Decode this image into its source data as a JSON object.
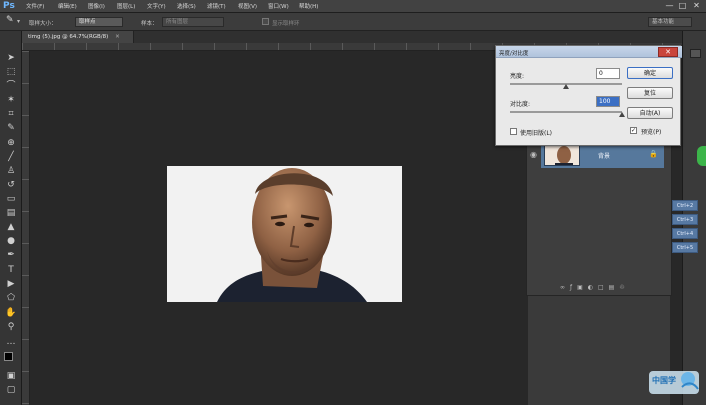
{
  "app": {
    "logo": "Ps"
  },
  "menu": [
    "文件(F)",
    "编辑(E)",
    "图像(I)",
    "图层(L)",
    "文字(Y)",
    "选择(S)",
    "滤镜(T)",
    "视图(V)",
    "窗口(W)",
    "帮助(H)"
  ],
  "window_buttons": [
    "—",
    "□",
    "✕"
  ],
  "options_bar": {
    "sample_size_label": "取样大小：",
    "sample_size_value": "取样点",
    "sample_label": "样本：",
    "sample_value": "所有图层",
    "show_ring_label": "显示取样环",
    "workspace_value": "基本功能"
  },
  "document": {
    "tab_label": "timg (5).jpg @ 64.7%(RGB/8)"
  },
  "dialog": {
    "title": "亮度/对比度",
    "close": "✕",
    "brightness_label": "亮度:",
    "brightness_value": "0",
    "contrast_label": "对比度:",
    "contrast_value": "100",
    "ok_label": "确定",
    "reset_label": "复位",
    "auto_label": "自动(A)",
    "preview_label": "预览(P)",
    "preview_checked": true,
    "legacy_label": "使用旧版(L)",
    "legacy_checked": false,
    "brightness_level": 0,
    "contrast_level": 100
  },
  "layers": {
    "background_layer_name": "背景"
  },
  "shortcuts": [
    "Ctrl+2",
    "Ctrl+3",
    "Ctrl+4",
    "Ctrl+5"
  ],
  "watermark_text": "中国学",
  "colors": {
    "dialog_title": "#b9cbe2",
    "layer_selected": "#56789c",
    "close_button": "#c9453c",
    "selection": "#3b6fc4"
  }
}
